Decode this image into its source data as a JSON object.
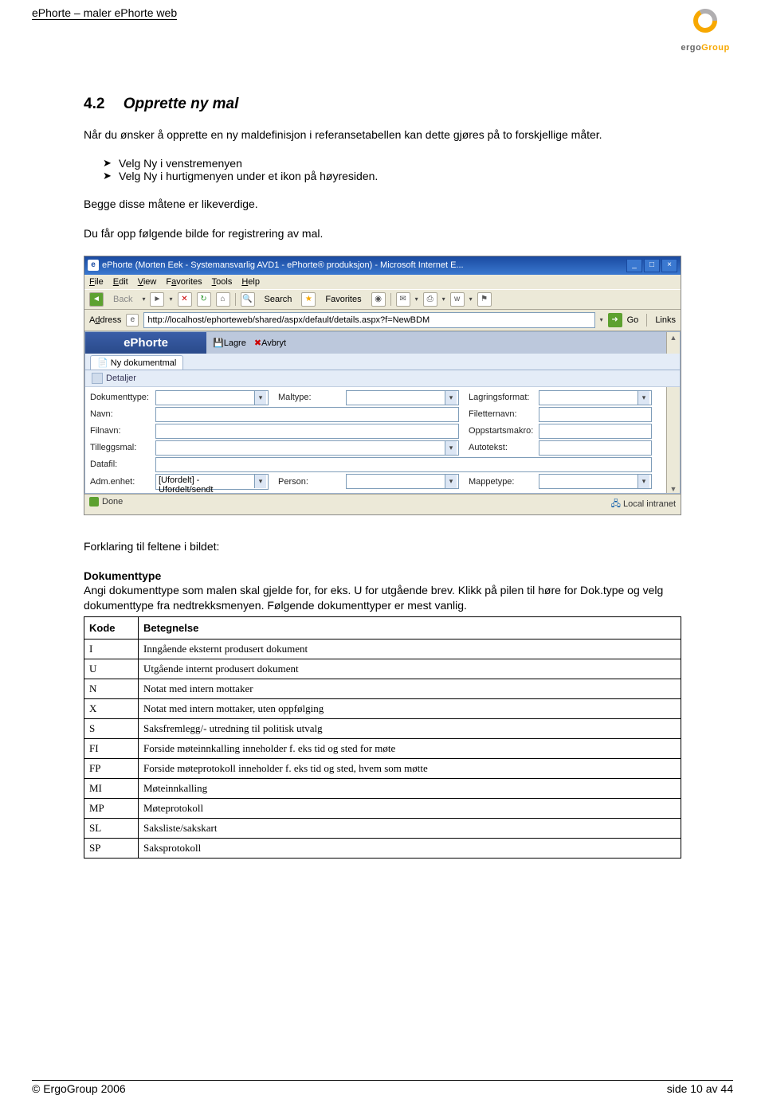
{
  "header": {
    "left": "ePhorte – maler ePhorte web"
  },
  "logo": {
    "name": "ErgoGroup",
    "brand_pre": "ergo",
    "brand_hi": "Group"
  },
  "h2": {
    "num": "4.2",
    "title": "Opprette ny mal"
  },
  "para1": "Når du ønsker å opprette en ny maldefinisjon i referansetabellen kan dette gjøres på to forskjellige måter.",
  "bullets": [
    "Velg Ny i venstremenyen",
    "Velg Ny i hurtigmenyen under et ikon på høyresiden."
  ],
  "para2": "Begge disse måtene er likeverdige.",
  "para3": "Du får opp følgende bilde for registrering av mal.",
  "screenshot": {
    "title": "ePhorte (Morten Eek - Systemansvarlig AVD1 - ePhorte® produksjon) - Microsoft Internet E...",
    "menu": [
      "File",
      "Edit",
      "View",
      "Favorites",
      "Tools",
      "Help"
    ],
    "toolbar": {
      "back": "Back",
      "search": "Search",
      "fav": "Favorites"
    },
    "address_label": "Address",
    "address": "http://localhost/ephorteweb/shared/aspx/default/details.aspx?f=NewBDM",
    "go": "Go",
    "links": "Links",
    "ephorte": "ePhorte",
    "save": "Lagre",
    "cancel": "Avbryt",
    "tab": "Ny dokumentmal",
    "panel": "Detaljer",
    "labels": {
      "doktype": "Dokumenttype:",
      "maltype": "Maltype:",
      "lagring": "Lagringsformat:",
      "navn": "Navn:",
      "filnavn": "Filnavn:",
      "tillegg": "Tilleggsmal:",
      "datafil": "Datafil:",
      "adm": "Adm.enhet:",
      "filetter": "Filetternavn:",
      "oppstart": "Oppstartsmakro:",
      "autotekst": "Autotekst:",
      "person": "Person:",
      "mappetype": "Mappetype:"
    },
    "adm_value": "[Ufordelt] - Ufordelt/sendt",
    "status_done": "Done",
    "status_intranet": "Local intranet"
  },
  "para4": "Forklaring til feltene i bildet:",
  "doktype_head": "Dokumenttype",
  "doktype_text": "Angi dokumenttype som malen skal gjelde for, for eks. U for utgående brev. Klikk på pilen til høre for Dok.type og velg dokumenttype fra nedtrekksmenyen. Følgende dokumenttyper er mest vanlig.",
  "table": {
    "head_kode": "Kode",
    "head_bet": "Betegnelse",
    "rows": [
      {
        "kode": "I",
        "bet": "Inngående eksternt produsert dokument"
      },
      {
        "kode": "U",
        "bet": "Utgående internt produsert dokument"
      },
      {
        "kode": "N",
        "bet": "Notat med intern mottaker"
      },
      {
        "kode": "X",
        "bet": "Notat med intern mottaker, uten oppfølging"
      },
      {
        "kode": "S",
        "bet": "Saksfremlegg/- utredning til politisk utvalg"
      },
      {
        "kode": "FI",
        "bet": "Forside møteinnkalling inneholder f. eks tid og sted for møte"
      },
      {
        "kode": "FP",
        "bet": "Forside møteprotokoll inneholder f. eks tid og sted, hvem som møtte"
      },
      {
        "kode": "MI",
        "bet": "Møteinnkalling"
      },
      {
        "kode": "MP",
        "bet": "Møteprotokoll"
      },
      {
        "kode": "SL",
        "bet": "Saksliste/sakskart"
      },
      {
        "kode": "SP",
        "bet": "Saksprotokoll"
      }
    ]
  },
  "footer": {
    "left": "© ErgoGroup 2006",
    "right": "side 10 av 44"
  }
}
